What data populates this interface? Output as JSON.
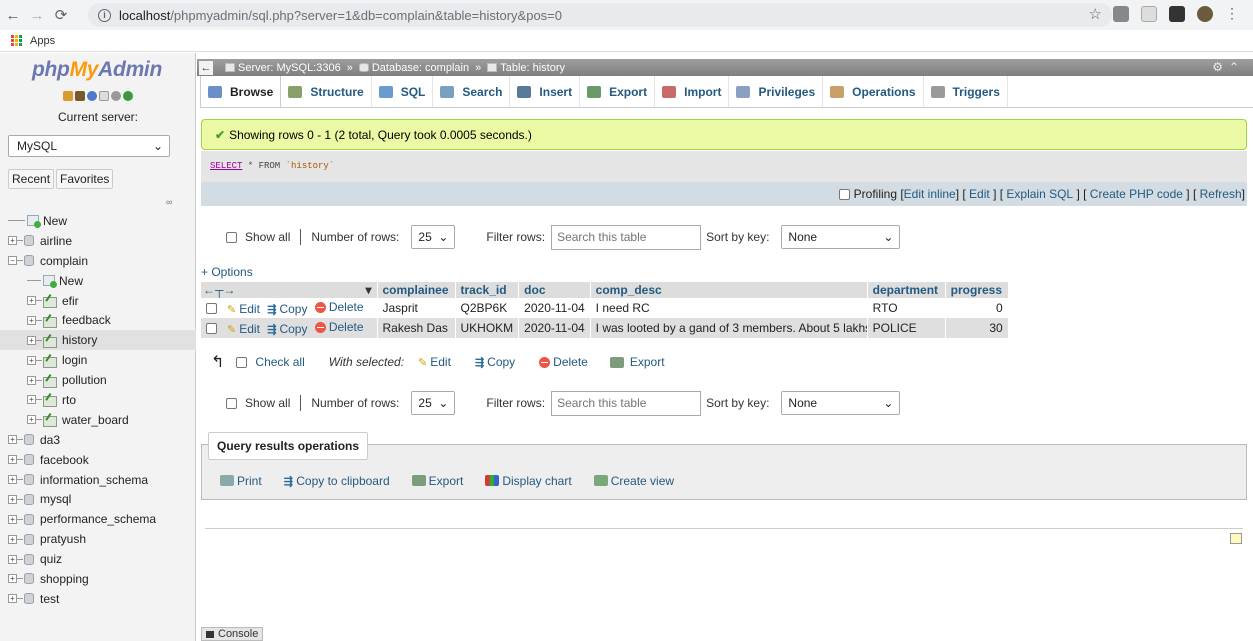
{
  "browser": {
    "url_host": "localhost",
    "url_path": "/phpmyadmin/sql.php?server=1&db=complain&table=history&pos=0",
    "bookmarks_apps": "Apps"
  },
  "nav": {
    "logo_php": "php",
    "logo_my": "My",
    "logo_admin": "Admin",
    "current_server_label": "Current server:",
    "server_value": "MySQL",
    "recent": "Recent",
    "favorites": "Favorites",
    "tree": [
      {
        "label": "New",
        "type": "new",
        "level": 0
      },
      {
        "label": "airline",
        "type": "db",
        "level": 0
      },
      {
        "label": "complain",
        "type": "db",
        "level": 0,
        "expanded": true
      },
      {
        "label": "New",
        "type": "new",
        "level": 1
      },
      {
        "label": "efir",
        "type": "table",
        "level": 1
      },
      {
        "label": "feedback",
        "type": "table",
        "level": 1
      },
      {
        "label": "history",
        "type": "table",
        "level": 1,
        "selected": true
      },
      {
        "label": "login",
        "type": "table",
        "level": 1
      },
      {
        "label": "pollution",
        "type": "table",
        "level": 1
      },
      {
        "label": "rto",
        "type": "table",
        "level": 1
      },
      {
        "label": "water_board",
        "type": "table",
        "level": 1
      },
      {
        "label": "da3",
        "type": "db",
        "level": 0
      },
      {
        "label": "facebook",
        "type": "db",
        "level": 0
      },
      {
        "label": "information_schema",
        "type": "db",
        "level": 0
      },
      {
        "label": "mysql",
        "type": "db",
        "level": 0
      },
      {
        "label": "performance_schema",
        "type": "db",
        "level": 0
      },
      {
        "label": "pratyush",
        "type": "db",
        "level": 0
      },
      {
        "label": "quiz",
        "type": "db",
        "level": 0
      },
      {
        "label": "shopping",
        "type": "db",
        "level": 0
      },
      {
        "label": "test",
        "type": "db",
        "level": 0
      }
    ]
  },
  "breadcrumb": {
    "server": "Server: MySQL:3306",
    "database": "Database: complain",
    "table": "Table: history"
  },
  "tabs": [
    "Browse",
    "Structure",
    "SQL",
    "Search",
    "Insert",
    "Export",
    "Import",
    "Privileges",
    "Operations",
    "Triggers"
  ],
  "result_message": "Showing rows 0 - 1 (2 total, Query took 0.0005 seconds.)",
  "sql": {
    "keyword": "SELECT",
    "rest": " * FROM ",
    "table": "`history`"
  },
  "sql_options": {
    "profiling": "Profiling",
    "edit_inline": "Edit inline",
    "edit": "Edit",
    "explain": "Explain SQL",
    "create_php": "Create PHP code",
    "refresh": "Refresh"
  },
  "navigation": {
    "show_all": "Show all",
    "rows_label": "Number of rows:",
    "rows_value": "25",
    "filter_label": "Filter rows:",
    "filter_placeholder": "Search this table",
    "sort_label": "Sort by key:",
    "sort_value": "None"
  },
  "options_link": "+ Options",
  "table": {
    "columns": [
      "complainee",
      "track_id",
      "doc",
      "comp_desc",
      "department",
      "progress"
    ],
    "row_actions": {
      "edit": "Edit",
      "copy": "Copy",
      "delete": "Delete"
    },
    "rows": [
      {
        "complainee": "Jasprit",
        "track_id": "Q2BP6K",
        "doc": "2020-11-04",
        "comp_desc": "I need RC",
        "department": "RTO",
        "progress": "0"
      },
      {
        "complainee": "Rakesh Das",
        "track_id": "UKHOKM",
        "doc": "2020-11-04",
        "comp_desc": "I was looted by a gand of 3 members. About 5 lakhs...",
        "department": "POLICE",
        "progress": "30"
      }
    ]
  },
  "bulk": {
    "check_all": "Check all",
    "with_selected": "With selected:",
    "edit": "Edit",
    "copy": "Copy",
    "delete": "Delete",
    "export": "Export"
  },
  "query_ops": {
    "title": "Query results operations",
    "print": "Print",
    "copy_clipboard": "Copy to clipboard",
    "export": "Export",
    "display_chart": "Display chart",
    "create_view": "Create view"
  },
  "console": "Console",
  "colors": {
    "link": "#235a81",
    "success_bg": "#ebf8a4",
    "header_bg": "#ddd"
  }
}
